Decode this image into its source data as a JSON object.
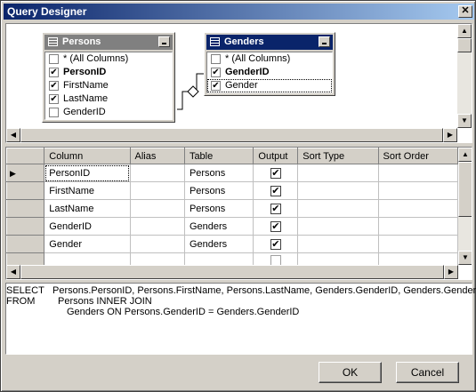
{
  "window": {
    "title": "Query Designer"
  },
  "diagram": {
    "persons": {
      "title": "Persons",
      "rows": [
        {
          "label": "* (All Columns)",
          "checked": false,
          "bold": false
        },
        {
          "label": "PersonID",
          "checked": true,
          "bold": true
        },
        {
          "label": "FirstName",
          "checked": true,
          "bold": false
        },
        {
          "label": "LastName",
          "checked": true,
          "bold": false
        },
        {
          "label": "GenderID",
          "checked": false,
          "bold": false
        }
      ]
    },
    "genders": {
      "title": "Genders",
      "rows": [
        {
          "label": "* (All Columns)",
          "checked": false,
          "bold": false
        },
        {
          "label": "GenderID",
          "checked": true,
          "bold": true
        },
        {
          "label": "Gender",
          "checked": true,
          "bold": false
        }
      ]
    }
  },
  "grid": {
    "headers": [
      "Column",
      "Alias",
      "Table",
      "Output",
      "Sort Type",
      "Sort Order"
    ],
    "rows": [
      {
        "column": "PersonID",
        "alias": "",
        "table": "Persons",
        "output": true
      },
      {
        "column": "FirstName",
        "alias": "",
        "table": "Persons",
        "output": true
      },
      {
        "column": "LastName",
        "alias": "",
        "table": "Persons",
        "output": true
      },
      {
        "column": "GenderID",
        "alias": "",
        "table": "Genders",
        "output": true
      },
      {
        "column": "Gender",
        "alias": "",
        "table": "Genders",
        "output": true
      }
    ]
  },
  "sql": {
    "line1_kw": "SELECT",
    "line1": "Persons.PersonID, Persons.FirstName, Persons.LastName, Genders.GenderID, Genders.Gender",
    "line2_kw": "FROM",
    "line2": "Persons INNER JOIN",
    "line3": "Genders ON Persons.GenderID = Genders.GenderID"
  },
  "buttons": {
    "ok": "OK",
    "cancel": "Cancel"
  },
  "colors": {
    "active_title": "#0a246a",
    "inactive_title": "#808080"
  }
}
